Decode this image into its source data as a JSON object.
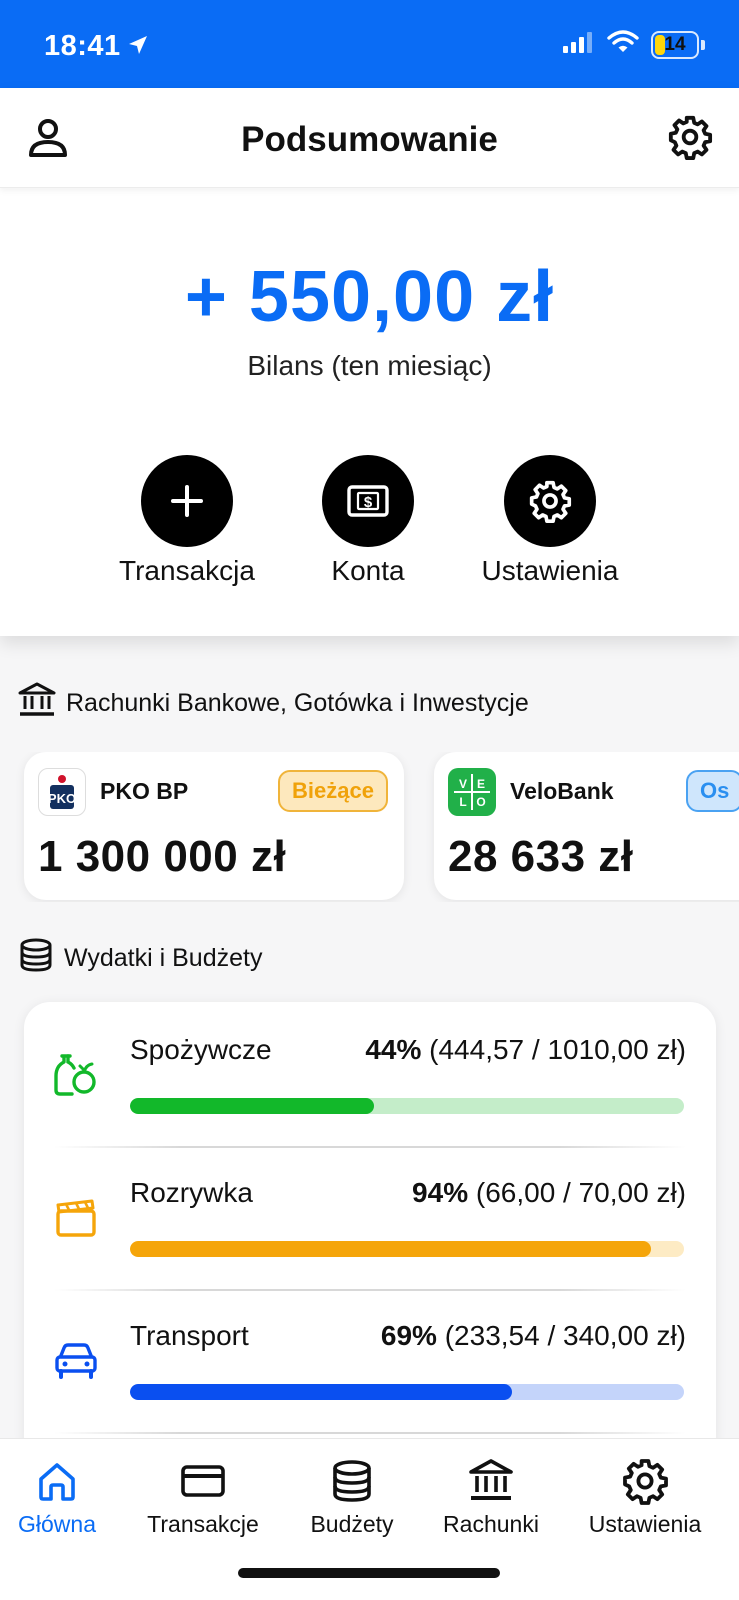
{
  "status_bar": {
    "time": "18:41",
    "battery": "14"
  },
  "header": {
    "title": "Podsumowanie"
  },
  "balance": {
    "amount": "+ 550,00 zł",
    "label": "Bilans (ten miesiąc)"
  },
  "actions": [
    {
      "label": "Transakcja",
      "icon": "plus-icon"
    },
    {
      "label": "Konta",
      "icon": "money-icon"
    },
    {
      "label": "Ustawienia",
      "icon": "gear-icon"
    }
  ],
  "sections": {
    "accounts_title": "Rachunki Bankowe, Gotówka i Inwestycje",
    "budgets_title": "Wydatki i Budżety"
  },
  "accounts": [
    {
      "name": "PKO BP",
      "badge": "Bieżące",
      "amount": "1 300 000 zł"
    },
    {
      "name": "VeloBank",
      "badge": "Os",
      "amount": "28 633 zł"
    }
  ],
  "budgets": [
    {
      "name": "Spożywcze",
      "percent_text": "44%",
      "detail": "(444,57 / 1010,00 zł)",
      "progress": 0.44,
      "color": "#12b82a",
      "track": "#c4edc9",
      "icon": "grocery-icon"
    },
    {
      "name": "Rozrywka",
      "percent_text": "94%",
      "detail": "(66,00 / 70,00 zł)",
      "progress": 0.94,
      "color": "#f5a50a",
      "track": "#fdebc4",
      "icon": "clapperboard-icon"
    },
    {
      "name": "Transport",
      "percent_text": "69%",
      "detail": "(233,54 / 340,00 zł)",
      "progress": 0.69,
      "color": "#0a4ff0",
      "track": "#c4d4fa",
      "icon": "car-icon"
    }
  ],
  "tabs": [
    {
      "label": "Główna",
      "icon": "home-icon",
      "active": true
    },
    {
      "label": "Transakcje",
      "icon": "card-icon",
      "active": false
    },
    {
      "label": "Budżety",
      "icon": "database-icon",
      "active": false
    },
    {
      "label": "Rachunki",
      "icon": "bank-icon",
      "active": false
    },
    {
      "label": "Ustawienia",
      "icon": "gear-icon",
      "active": false
    }
  ],
  "colors": {
    "accent": "#0a6cf5"
  }
}
